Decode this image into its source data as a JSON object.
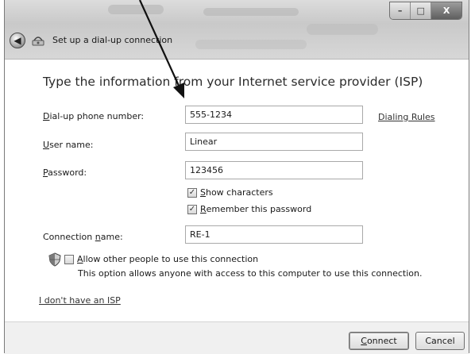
{
  "window": {
    "title": "Set up a dial-up connection",
    "controls": {
      "minimize": "–",
      "maximize": "□",
      "close": "X"
    }
  },
  "header": "Type the information from your Internet service provider (ISP)",
  "fields": {
    "phone": {
      "label_accel": "D",
      "label_rest": "ial-up phone number:",
      "value": "555-1234"
    },
    "user": {
      "label_accel": "U",
      "label_rest": "ser name:",
      "value": "Linear"
    },
    "password": {
      "label_accel": "P",
      "label_rest": "assword:",
      "value": "123456"
    },
    "connection": {
      "label_pre": "Connection ",
      "label_accel": "n",
      "label_rest": "ame:",
      "value": "RE-1"
    }
  },
  "dialing_rules": "Dialing Rules",
  "checkboxes": {
    "show_characters": {
      "accel": "S",
      "rest": "how characters",
      "checked": true
    },
    "remember_password": {
      "accel": "R",
      "rest": "emember this password",
      "checked": true
    },
    "allow_others": {
      "accel": "A",
      "rest": "llow other people to use this connection",
      "checked": false
    }
  },
  "allow_note": "This option allows anyone with access to this computer to use this connection.",
  "no_isp_link": "I don't have an ISP",
  "buttons": {
    "connect": {
      "accel": "C",
      "rest": "onnect"
    },
    "cancel": "Cancel"
  },
  "icons": {
    "back": "back-arrow-icon",
    "connection": "dialup-connection-icon",
    "shield": "uac-shield-icon"
  },
  "colors": {
    "titlebar": "#d0d0d0",
    "footer": "#f0f0f0",
    "text": "#1a1a1a"
  }
}
